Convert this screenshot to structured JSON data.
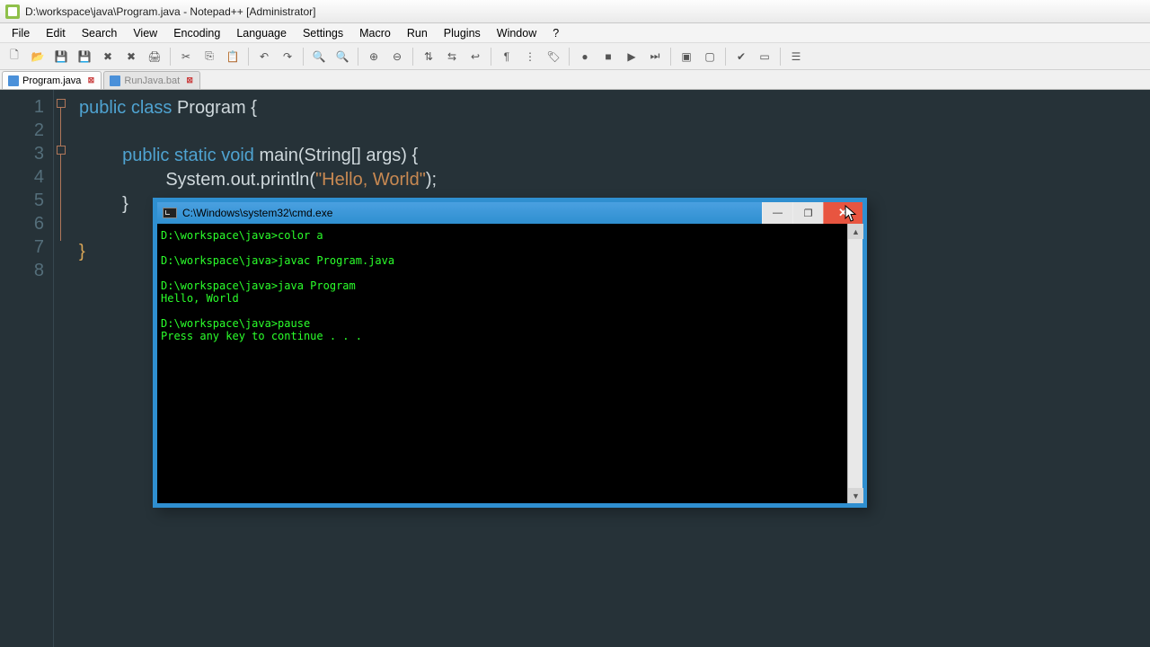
{
  "window": {
    "title": "D:\\workspace\\java\\Program.java - Notepad++  [Administrator]"
  },
  "menu": {
    "items": [
      "File",
      "Edit",
      "Search",
      "View",
      "Encoding",
      "Language",
      "Settings",
      "Macro",
      "Run",
      "Plugins",
      "Window",
      "?"
    ]
  },
  "toolbar_icons": [
    "new",
    "open",
    "save",
    "save-all",
    "close",
    "close-all",
    "print",
    "|",
    "cut",
    "copy",
    "paste",
    "|",
    "undo",
    "redo",
    "|",
    "find",
    "replace",
    "|",
    "zoom-in",
    "zoom-out",
    "|",
    "sync-v",
    "sync-h",
    "wrap",
    "|",
    "hidden-chars",
    "indent-guide",
    "lang",
    "|",
    "record",
    "stop",
    "play",
    "play-multi",
    "|",
    "fold",
    "unfold",
    "|",
    "spell",
    "doc-map",
    "|",
    "func-list"
  ],
  "tabs": [
    {
      "label": "Program.java",
      "active": true
    },
    {
      "label": "RunJava.bat",
      "active": false
    }
  ],
  "gutter_lines": [
    "1",
    "2",
    "3",
    "4",
    "5",
    "6",
    "7",
    "8"
  ],
  "code": {
    "l1_kw": "public class ",
    "l1_name": "Program ",
    "l1_brace": "{",
    "l3_kw": "public static void ",
    "l3_name": "main",
    "l3_args": "(String[] args) ",
    "l3_brace": "{",
    "l4_call": "System.out.println(",
    "l4_str": "\"Hello, World\"",
    "l4_end": ");",
    "l5_brace": "}",
    "l7_brace": "}"
  },
  "console": {
    "title": "C:\\Windows\\system32\\cmd.exe",
    "lines": [
      "D:\\workspace\\java>color a",
      "",
      "D:\\workspace\\java>javac Program.java",
      "",
      "D:\\workspace\\java>java Program",
      "Hello, World",
      "",
      "D:\\workspace\\java>pause",
      "Press any key to continue . . ."
    ],
    "min": "—",
    "max": "❐",
    "close": "✕"
  }
}
